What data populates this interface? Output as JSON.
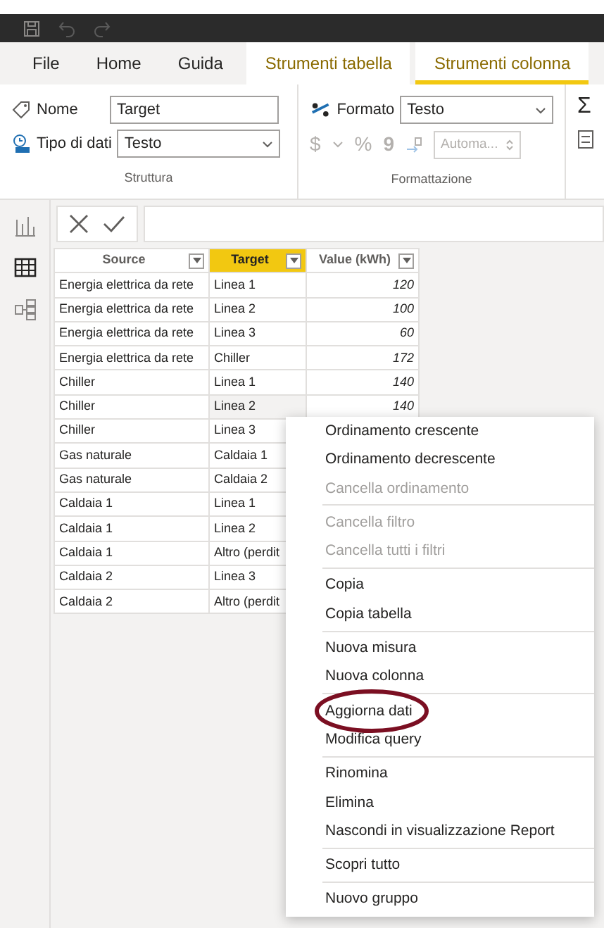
{
  "quick_access": [
    {
      "kind": "save"
    },
    {
      "kind": "undo"
    },
    {
      "kind": "redo"
    }
  ],
  "tabs": [
    {
      "label": "File",
      "kind": "plain",
      "selected": false
    },
    {
      "label": "Home",
      "kind": "plain",
      "selected": false
    },
    {
      "label": "Guida",
      "kind": "plain",
      "selected": false
    },
    {
      "label": "Strumenti tabella",
      "kind": "contextual",
      "selected": false
    },
    {
      "label": "Strumenti colonna",
      "kind": "contextual",
      "selected": true
    }
  ],
  "ribbon": {
    "struttura": {
      "name_label": "Nome",
      "name_value": "Target",
      "type_label": "Tipo di dati",
      "type_value": "Testo",
      "group_label": "Struttura"
    },
    "formattazione": {
      "format_label": "Formato",
      "format_value": "Testo",
      "currency": "$",
      "percent": "%",
      "comma": "9",
      "decimals_placeholder": "Automa...",
      "group_label": "Formattazione"
    },
    "overflow": [
      "Σ"
    ]
  },
  "views": [
    {
      "kind": "report",
      "selected": false
    },
    {
      "kind": "data",
      "selected": true
    },
    {
      "kind": "model",
      "selected": false
    }
  ],
  "table": {
    "columns": [
      {
        "label": "Source",
        "selected": false
      },
      {
        "label": "Target",
        "selected": true
      },
      {
        "label": "Value (kWh)",
        "selected": false
      }
    ],
    "rows": [
      [
        "Energia elettrica da rete",
        "Linea 1",
        "120"
      ],
      [
        "Energia elettrica da rete",
        "Linea 2",
        "100"
      ],
      [
        "Energia elettrica da rete",
        "Linea 3",
        "60"
      ],
      [
        "Energia elettrica da rete",
        "Chiller",
        "172"
      ],
      [
        "Chiller",
        "Linea 1",
        "140"
      ],
      [
        "Chiller",
        "Linea 2",
        "140"
      ],
      [
        "Chiller",
        "Linea 3"
      ],
      [
        "Gas naturale",
        "Caldaia 1"
      ],
      [
        "Gas naturale",
        "Caldaia 2"
      ],
      [
        "Caldaia 1",
        "Linea 1"
      ],
      [
        "Caldaia 1",
        "Linea 2"
      ],
      [
        "Caldaia 1",
        "Altro (perdit"
      ],
      [
        "Caldaia 2",
        "Linea 3"
      ],
      [
        "Caldaia 2",
        "Altro (perdit"
      ]
    ]
  },
  "context_menu": [
    [
      {
        "label": "Ordinamento crescente",
        "disabled": false,
        "circled": false
      },
      {
        "label": "Ordinamento decrescente",
        "disabled": false,
        "circled": false
      },
      {
        "label": "Cancella ordinamento",
        "disabled": true,
        "circled": false
      }
    ],
    [
      {
        "label": "Cancella filtro",
        "disabled": true,
        "circled": false
      },
      {
        "label": "Cancella tutti i filtri",
        "disabled": true,
        "circled": false
      }
    ],
    [
      {
        "label": "Copia",
        "disabled": false,
        "circled": false
      },
      {
        "label": "Copia tabella",
        "disabled": false,
        "circled": false
      }
    ],
    [
      {
        "label": "Nuova misura",
        "disabled": false,
        "circled": false
      },
      {
        "label": "Nuova colonna",
        "disabled": false,
        "circled": false
      }
    ],
    [
      {
        "label": "Aggiorna dati",
        "disabled": false,
        "circled": true
      },
      {
        "label": "Modifica query",
        "disabled": false,
        "circled": false
      }
    ],
    [
      {
        "label": "Rinomina",
        "disabled": false,
        "circled": false
      },
      {
        "label": "Elimina",
        "disabled": false,
        "circled": false
      },
      {
        "label": "Nascondi in visualizzazione Report",
        "disabled": false,
        "circled": false
      }
    ],
    [
      {
        "label": "Scopri tutto",
        "disabled": false,
        "circled": false
      }
    ],
    [
      {
        "label": "Nuovo gruppo",
        "disabled": false,
        "circled": false
      }
    ]
  ]
}
